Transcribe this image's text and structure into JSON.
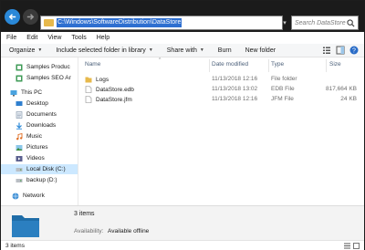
{
  "address": {
    "path": "C:\\Windows\\SoftwareDistribution\\DataStore",
    "search_placeholder": "Search DataStore"
  },
  "menu": [
    "File",
    "Edit",
    "View",
    "Tools",
    "Help"
  ],
  "commands": {
    "organize": "Organize",
    "include": "Include selected folder in library",
    "share": "Share with",
    "burn": "Burn",
    "new_folder": "New folder"
  },
  "nav": [
    {
      "label": "Samples Produc",
      "icon": "samples-icon"
    },
    {
      "label": "Samples SEO Ar",
      "icon": "samples-icon"
    },
    {
      "label": "This PC",
      "icon": "pc-icon"
    },
    {
      "label": "Desktop",
      "icon": "desktop-icon"
    },
    {
      "label": "Documents",
      "icon": "documents-icon"
    },
    {
      "label": "Downloads",
      "icon": "downloads-icon"
    },
    {
      "label": "Music",
      "icon": "music-icon"
    },
    {
      "label": "Pictures",
      "icon": "pictures-icon"
    },
    {
      "label": "Videos",
      "icon": "videos-icon"
    },
    {
      "label": "Local Disk (C:)",
      "icon": "disk-icon"
    },
    {
      "label": "backup (D:)",
      "icon": "disk-icon"
    },
    {
      "label": "Network",
      "icon": "network-icon"
    }
  ],
  "columns": {
    "name": "Name",
    "date": "Date modified",
    "type": "Type",
    "size": "Size"
  },
  "files": [
    {
      "name": "Logs",
      "date": "11/13/2018 12:16",
      "type": "File folder",
      "size": "",
      "icon": "folder-icon"
    },
    {
      "name": "DataStore.edb",
      "date": "11/13/2018 13:02",
      "type": "EDB File",
      "size": "817,664 KB",
      "icon": "file-icon"
    },
    {
      "name": "DataStore.jfm",
      "date": "11/13/2018 12:16",
      "type": "JFM File",
      "size": "24 KB",
      "icon": "file-icon"
    }
  ],
  "details": {
    "count": "3 items",
    "availability_label": "Availability:",
    "availability_value": "Available offline"
  },
  "status": {
    "text": "3 items"
  },
  "colors": {
    "accent": "#2a88d8",
    "selection": "#cce8ff",
    "titlebar": "#1b1b1b",
    "folder": "#e7b94c"
  }
}
